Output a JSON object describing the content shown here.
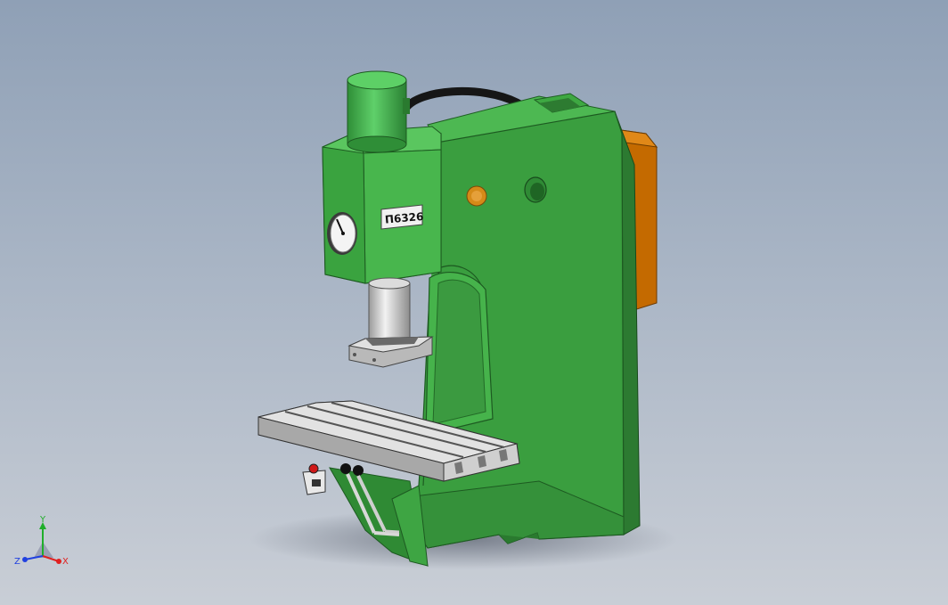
{
  "viewport": {
    "background_top": "#8fa0b6",
    "background_bottom": "#c9ced6"
  },
  "model": {
    "nameplate_text": "П6326",
    "colors": {
      "frame_green": "#3c9f40",
      "frame_light": "#4fbf52",
      "frame_dark": "#2e7d33",
      "cylinder_green": "#3fb04a",
      "motor_orange": "#c46a00",
      "table_grey": "#c8c8c8",
      "hose_black": "#161616"
    },
    "icons": [
      "pressure-gauge-icon"
    ]
  },
  "triad": {
    "x_label": "X",
    "y_label": "Y",
    "z_label": "Z",
    "colors": {
      "x": "#e02020",
      "y": "#1fae2a",
      "z": "#2040e0"
    }
  }
}
